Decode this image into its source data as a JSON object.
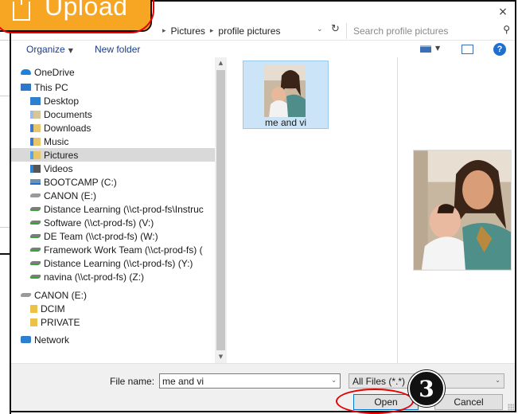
{
  "upload_button": {
    "label": "Upload"
  },
  "dialog": {
    "close_label": "×",
    "breadcrumb": [
      "Pictures",
      "profile pictures"
    ],
    "search_placeholder": "Search profile pictures",
    "toolbar": {
      "organize": "Organize",
      "new_folder": "New folder",
      "help": "?"
    },
    "nav": [
      {
        "label": "OneDrive",
        "icon": "cloud-icon",
        "indent": 1,
        "selected": false
      },
      {
        "label": "This PC",
        "icon": "computer-icon",
        "indent": 1,
        "selected": false
      },
      {
        "label": "Desktop",
        "icon": "desktop-folder-icon",
        "indent": 2,
        "selected": false
      },
      {
        "label": "Documents",
        "icon": "documents-folder-icon",
        "indent": 2,
        "selected": false
      },
      {
        "label": "Downloads",
        "icon": "downloads-folder-icon",
        "indent": 2,
        "selected": false
      },
      {
        "label": "Music",
        "icon": "music-folder-icon",
        "indent": 2,
        "selected": false
      },
      {
        "label": "Pictures",
        "icon": "pictures-folder-icon",
        "indent": 2,
        "selected": true
      },
      {
        "label": "Videos",
        "icon": "videos-folder-icon",
        "indent": 2,
        "selected": false
      },
      {
        "label": "BOOTCAMP (C:)",
        "icon": "drive-icon",
        "indent": 2,
        "selected": false
      },
      {
        "label": "CANON (E:)",
        "icon": "usb-drive-icon",
        "indent": 2,
        "selected": false
      },
      {
        "label": "Distance Learning (\\\\ct-prod-fs\\Instruc",
        "icon": "network-drive-icon",
        "indent": 2,
        "selected": false
      },
      {
        "label": "Software (\\\\ct-prod-fs) (V:)",
        "icon": "network-drive-icon",
        "indent": 2,
        "selected": false
      },
      {
        "label": "DE Team (\\\\ct-prod-fs) (W:)",
        "icon": "network-drive-icon",
        "indent": 2,
        "selected": false
      },
      {
        "label": "Framework Work Team (\\\\ct-prod-fs) (",
        "icon": "network-drive-icon",
        "indent": 2,
        "selected": false
      },
      {
        "label": "Distance Learning (\\\\ct-prod-fs) (Y:)",
        "icon": "network-drive-icon",
        "indent": 2,
        "selected": false
      },
      {
        "label": "navina (\\\\ct-prod-fs) (Z:)",
        "icon": "network-drive-icon",
        "indent": 2,
        "selected": false
      },
      {
        "label": "CANON (E:)",
        "icon": "usb-drive-icon",
        "indent": 1,
        "selected": false
      },
      {
        "label": "DCIM",
        "icon": "folder-icon",
        "indent": 2,
        "selected": false
      },
      {
        "label": "PRIVATE",
        "icon": "folder-icon",
        "indent": 2,
        "selected": false
      },
      {
        "label": "Network",
        "icon": "network-icon",
        "indent": 1,
        "selected": false
      }
    ],
    "files": [
      {
        "name": "me and vi",
        "selected": true
      }
    ],
    "footer": {
      "file_name_label": "File name:",
      "file_name_value": "me and vi",
      "file_type": "All Files (*.*)",
      "open_label": "Open",
      "cancel_label": "Cancel"
    }
  },
  "step_badge": "3",
  "colors": {
    "accent": "#0078d7",
    "highlight": "#e60000",
    "upload_orange": "#f6a623",
    "selection": "#cce4f7"
  }
}
